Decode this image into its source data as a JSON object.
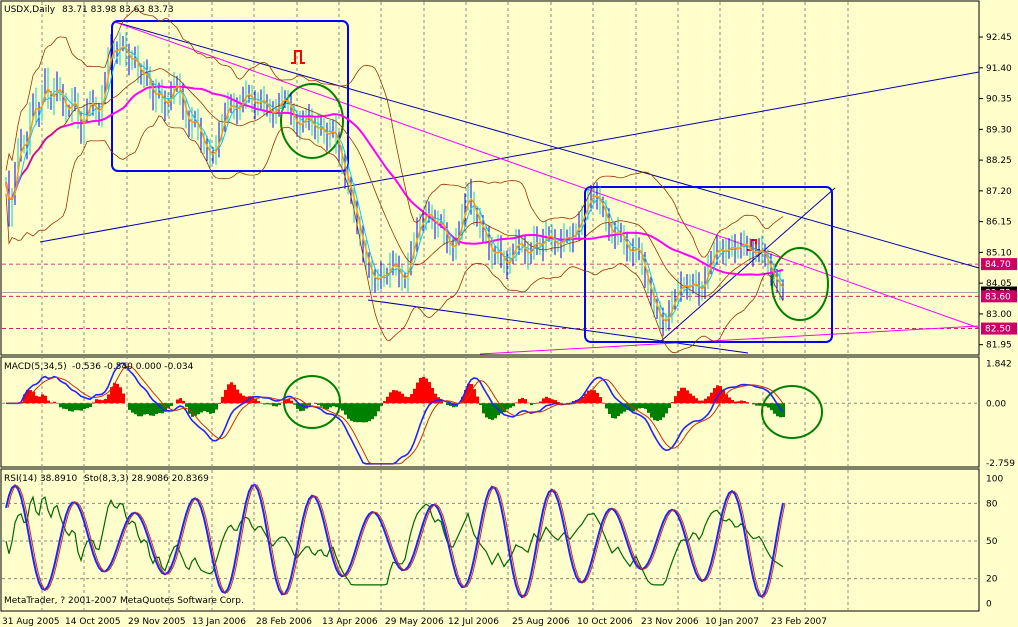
{
  "colors": {
    "background": "#ffffcc",
    "candle": "#0000ff",
    "candle_alt": "#00cccc",
    "ma_fast": "#ff9900",
    "ma_mid": "#00ccff",
    "ma_long": "#ff00ff",
    "bollinger": "#993300",
    "macd_pos": "#ff0000",
    "macd_neg": "#008000",
    "rsi_line": "#2222ff",
    "rsi_signal": "#cc3300",
    "stoch_line": "#006600",
    "channel_line": "#0000aa",
    "box": "#0000ff",
    "circle": "#008000",
    "grid": "#888888"
  },
  "chart_data": [
    {
      "type": "candlestick",
      "title": "USDX,Daily",
      "ohlc_readout": "83.71 83.98 83.63 83.73",
      "y_ticks": [
        "92.45",
        "91.40",
        "90.35",
        "89.30",
        "88.25",
        "87.20",
        "86.15",
        "85.10",
        "84.05",
        "83.00",
        "81.95"
      ],
      "ylim": [
        81.7,
        93.1
      ],
      "price_labels": [
        {
          "value": 84.7,
          "text": "84.70",
          "color": "#cc0066"
        },
        {
          "value": 83.73,
          "text": "83.73",
          "color": "#000000"
        },
        {
          "value": 83.6,
          "text": "83.60",
          "color": "#cc0066"
        },
        {
          "value": 82.5,
          "text": "82.50",
          "color": "#cc0066"
        }
      ],
      "price_path": [
        [
          0,
          87.5
        ],
        [
          4,
          86.0
        ],
        [
          8,
          87.8
        ],
        [
          14,
          89.0
        ],
        [
          20,
          88.5
        ],
        [
          26,
          90.5
        ],
        [
          32,
          89.5
        ],
        [
          38,
          91.2
        ],
        [
          44,
          90.0
        ],
        [
          50,
          91.0
        ],
        [
          56,
          90.2
        ],
        [
          62,
          89.8
        ],
        [
          68,
          90.6
        ],
        [
          74,
          89.0
        ],
        [
          80,
          90.1
        ],
        [
          86,
          90.3
        ],
        [
          92,
          89.6
        ],
        [
          98,
          90.8
        ],
        [
          104,
          92.2
        ],
        [
          110,
          91.8
        ],
        [
          116,
          92.4
        ],
        [
          122,
          91.5
        ],
        [
          128,
          91.9
        ],
        [
          134,
          91.0
        ],
        [
          140,
          91.4
        ],
        [
          146,
          90.2
        ],
        [
          152,
          90.8
        ],
        [
          158,
          89.9
        ],
        [
          164,
          90.5
        ],
        [
          170,
          91.0
        ],
        [
          176,
          90.2
        ],
        [
          182,
          89.3
        ],
        [
          188,
          89.8
        ],
        [
          194,
          89.0
        ],
        [
          200,
          88.6
        ],
        [
          206,
          88.3
        ],
        [
          212,
          89.0
        ],
        [
          218,
          89.8
        ],
        [
          224,
          90.3
        ],
        [
          230,
          89.8
        ],
        [
          236,
          90.4
        ],
        [
          242,
          90.6
        ],
        [
          248,
          90.0
        ],
        [
          254,
          90.4
        ],
        [
          260,
          90.1
        ],
        [
          266,
          89.7
        ],
        [
          272,
          90.2
        ],
        [
          278,
          90.4
        ],
        [
          284,
          90.0
        ],
        [
          290,
          89.3
        ],
        [
          296,
          89.6
        ],
        [
          302,
          89.8
        ],
        [
          308,
          89.2
        ],
        [
          314,
          89.5
        ],
        [
          320,
          88.9
        ],
        [
          326,
          89.5
        ],
        [
          332,
          88.6
        ],
        [
          338,
          87.8
        ],
        [
          344,
          87.2
        ],
        [
          350,
          86.2
        ],
        [
          356,
          85.3
        ],
        [
          362,
          84.6
        ],
        [
          368,
          84.0
        ],
        [
          374,
          84.4
        ],
        [
          380,
          84.2
        ],
        [
          386,
          84.9
        ],
        [
          392,
          84.4
        ],
        [
          398,
          84.0
        ],
        [
          404,
          85.0
        ],
        [
          410,
          85.8
        ],
        [
          416,
          86.2
        ],
        [
          422,
          86.6
        ],
        [
          428,
          85.9
        ],
        [
          434,
          86.3
        ],
        [
          440,
          85.5
        ],
        [
          446,
          85.1
        ],
        [
          452,
          85.8
        ],
        [
          458,
          86.6
        ],
        [
          462,
          87.2
        ],
        [
          468,
          86.4
        ],
        [
          474,
          86.0
        ],
        [
          480,
          85.6
        ],
        [
          486,
          84.9
        ],
        [
          492,
          85.3
        ],
        [
          498,
          84.6
        ],
        [
          504,
          84.9
        ],
        [
          510,
          85.5
        ],
        [
          516,
          85.3
        ],
        [
          522,
          84.9
        ],
        [
          528,
          85.6
        ],
        [
          534,
          85.2
        ],
        [
          540,
          85.8
        ],
        [
          546,
          85.5
        ],
        [
          552,
          85.3
        ],
        [
          558,
          85.7
        ],
        [
          564,
          85.5
        ],
        [
          570,
          85.9
        ],
        [
          576,
          86.3
        ],
        [
          582,
          86.9
        ],
        [
          588,
          87.1
        ],
        [
          594,
          86.8
        ],
        [
          600,
          86.2
        ],
        [
          606,
          85.6
        ],
        [
          612,
          85.9
        ],
        [
          618,
          85.4
        ],
        [
          624,
          85.0
        ],
        [
          630,
          85.4
        ],
        [
          636,
          84.7
        ],
        [
          642,
          83.9
        ],
        [
          648,
          83.3
        ],
        [
          654,
          82.8
        ],
        [
          658,
          82.6
        ],
        [
          664,
          83.2
        ],
        [
          670,
          83.7
        ],
        [
          676,
          84.1
        ],
        [
          682,
          83.8
        ],
        [
          688,
          84.2
        ],
        [
          694,
          83.6
        ],
        [
          700,
          84.4
        ],
        [
          706,
          85.0
        ],
        [
          712,
          85.3
        ],
        [
          718,
          85.0
        ],
        [
          724,
          85.4
        ],
        [
          730,
          85.1
        ],
        [
          736,
          85.5
        ],
        [
          742,
          85.2
        ],
        [
          748,
          85.0
        ],
        [
          754,
          85.3
        ],
        [
          760,
          84.8
        ],
        [
          766,
          84.3
        ],
        [
          772,
          84.0
        ],
        [
          778,
          83.7
        ]
      ]
    },
    {
      "type": "histogram",
      "title": "MACD(5,34,5)",
      "readout": "-0.536 -0.540 0.000 -0.034",
      "y_ticks": [
        "1.842",
        "0.00",
        "-2.759"
      ],
      "ylim": [
        -2.9,
        2.0
      ]
    },
    {
      "type": "line",
      "title": "RSI(14) 38.8910",
      "readout2": "Sto(8,3,3) 28.9086 20.8369",
      "y_ticks": [
        "100",
        "80",
        "50",
        "20",
        "0"
      ],
      "ylim": [
        -5,
        105
      ]
    }
  ],
  "x_ticks": [
    "31 Aug 2005",
    "14 Oct 2005",
    "29 Nov 2005",
    "13 Jan 2006",
    "28 Feb 2006",
    "13 Apr 2006",
    "29 May 2006",
    "12 Jul 2006",
    "25 Aug 2006",
    "10 Oct 2006",
    "23 Nov 2006",
    "10 Jan 2007",
    "23 Feb 2007"
  ],
  "copyright": "MetaTrader, ? 2001-2007 MetaQuotes Software Corp."
}
